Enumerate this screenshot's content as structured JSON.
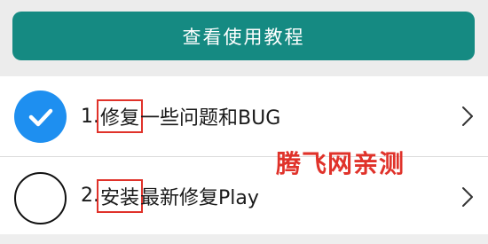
{
  "colors": {
    "accent": "#158a82",
    "check_blue": "#1e8ff0",
    "highlight_red": "#e0322a",
    "watermark_red": "#e0322a"
  },
  "tutorial_button": {
    "label": "查看使用教程"
  },
  "items": [
    {
      "checked": true,
      "number": "1.",
      "highlight": "修复",
      "rest": "一些问题和BUG",
      "check_icon": "checkmark-icon",
      "chevron_icon": "chevron-right-icon"
    },
    {
      "checked": false,
      "number": "2.",
      "highlight": "安装",
      "rest": "最新修复Play",
      "check_icon": "empty-circle-icon",
      "chevron_icon": "chevron-right-icon"
    }
  ],
  "watermark": "腾飞网亲测"
}
